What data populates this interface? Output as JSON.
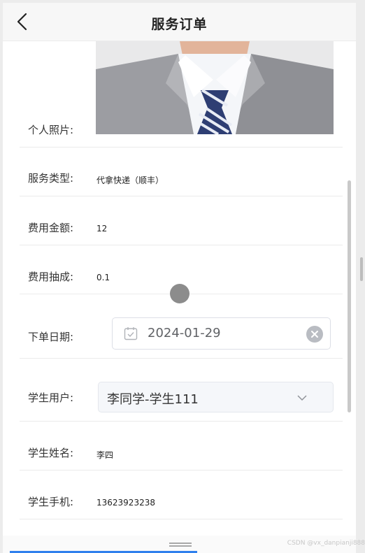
{
  "header": {
    "title": "服务订单",
    "back_icon": "chevron-left-icon"
  },
  "fields": {
    "photo": {
      "label": "个人照片:"
    },
    "service_type": {
      "label": "服务类型:",
      "value": "代拿快递（顺丰）"
    },
    "fee_amount": {
      "label": "费用金额:",
      "value": "12"
    },
    "fee_commission": {
      "label": "费用抽成:",
      "value": "0.1"
    },
    "order_date": {
      "label": "下单日期:",
      "value": "2024-01-29",
      "icon": "calendar-icon",
      "clear_icon": "clear-icon"
    },
    "student_user": {
      "label": "学生用户:",
      "value": "李同学-学生111",
      "icon": "chevron-down-icon"
    },
    "student_name": {
      "label": "学生姓名:",
      "value": "李四"
    },
    "student_phone": {
      "label": "学生手机:",
      "value": "13623923238"
    }
  },
  "footer": {
    "watermark": "CSDN @vx_danpianji888"
  },
  "colors": {
    "accent": "#2f80ed",
    "input_border": "#dcdfe6",
    "clear_bg": "#b9bcc2"
  }
}
